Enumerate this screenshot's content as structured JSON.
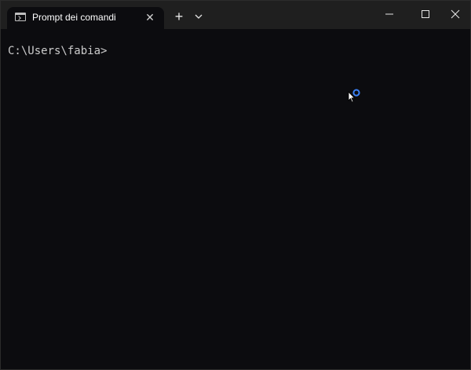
{
  "window": {
    "tab": {
      "title": "Prompt dei comandi",
      "close_glyph": "✕",
      "icon": "terminal-icon"
    },
    "new_tab_glyph": "+",
    "dropdown_icon": "chevron-down-icon",
    "controls": {
      "minimize_icon": "minimize-icon",
      "maximize_icon": "maximize-icon",
      "close_icon": "close-icon"
    }
  },
  "terminal": {
    "prompt": "C:\\Users\\fabia>"
  },
  "colors": {
    "titlebar": "#1f1f1f",
    "background": "#0c0c0f",
    "text": "#cccccc",
    "busy_indicator": "#3b82f6"
  }
}
